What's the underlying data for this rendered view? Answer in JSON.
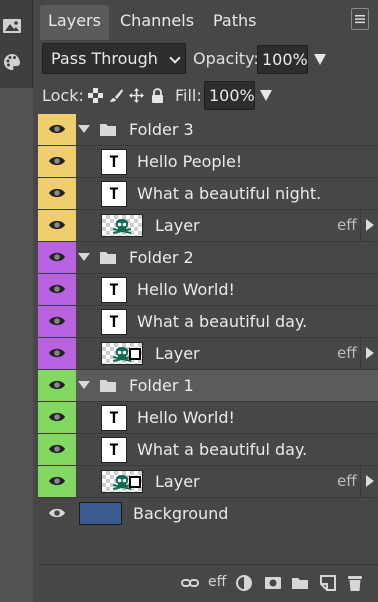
{
  "tabs": [
    "Layers",
    "Channels",
    "Paths"
  ],
  "menu_icon": "hamburger-icon",
  "blend_mode": "Pass Through",
  "opacity": {
    "label": "Opacity:",
    "value": "100%"
  },
  "lock": {
    "label": "Lock:",
    "icons": [
      "lock-transparency-icon",
      "lock-paint-icon",
      "lock-move-icon",
      "lock-all-icon"
    ]
  },
  "fill": {
    "label": "Fill:",
    "value": "100%"
  },
  "colors": {
    "yellow": "#efce6b",
    "purple": "#b863e2",
    "green": "#82d961",
    "panel": "#474747",
    "selected_row": "#5b5b5b",
    "background_swatch": "#3b5a8d"
  },
  "layers": [
    {
      "kind": "folder",
      "name": "Folder 3",
      "color": "yellow",
      "indent": 0,
      "selected": false
    },
    {
      "kind": "text",
      "name": "Hello People!",
      "color": "yellow",
      "indent": 1
    },
    {
      "kind": "text",
      "name": "What a beautiful night.",
      "color": "yellow",
      "indent": 1
    },
    {
      "kind": "image",
      "name": "Layer",
      "color": "yellow",
      "indent": 1,
      "mask": false,
      "fx": "eff"
    },
    {
      "kind": "folder",
      "name": "Folder 2",
      "color": "purple",
      "indent": 0,
      "selected": false
    },
    {
      "kind": "text",
      "name": "Hello World!",
      "color": "purple",
      "indent": 1
    },
    {
      "kind": "text",
      "name": "What a beautiful day.",
      "color": "purple",
      "indent": 1
    },
    {
      "kind": "image",
      "name": "Layer",
      "color": "purple",
      "indent": 1,
      "mask": true,
      "fx": "eff"
    },
    {
      "kind": "folder",
      "name": "Folder 1",
      "color": "green",
      "indent": 0,
      "selected": true
    },
    {
      "kind": "text",
      "name": "Hello World!",
      "color": "green",
      "indent": 1
    },
    {
      "kind": "text",
      "name": "What a beautiful day.",
      "color": "green",
      "indent": 1
    },
    {
      "kind": "image",
      "name": "Layer",
      "color": "green",
      "indent": 1,
      "mask": true,
      "fx": "eff"
    },
    {
      "kind": "background",
      "name": "Background",
      "color": "none",
      "indent": 0
    }
  ],
  "footer": {
    "fx_label": "eff",
    "icons": [
      "link-icon",
      "fx-icon",
      "adjustment-icon",
      "mask-icon",
      "new-folder-icon",
      "new-layer-icon",
      "trash-icon"
    ]
  }
}
